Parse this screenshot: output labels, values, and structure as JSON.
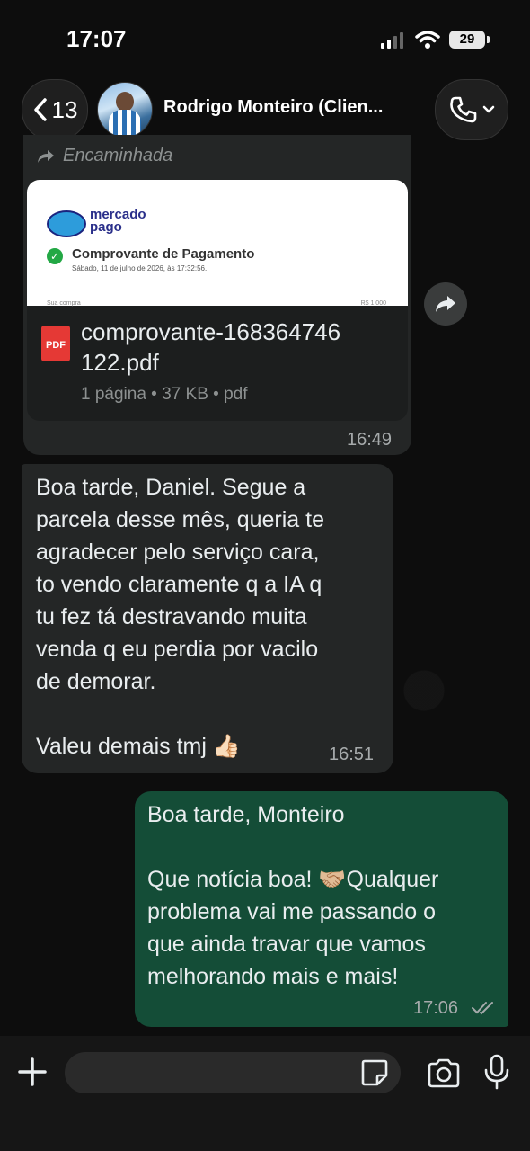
{
  "status_bar": {
    "time": "17:07",
    "battery": "29"
  },
  "header": {
    "back_count": "13",
    "contact_name": "Rodrigo Monteiro (Clien..."
  },
  "messages": {
    "forwarded": {
      "label": "Encaminhada",
      "preview": {
        "brand_line1": "mercado",
        "brand_line2": "pago",
        "title": "Comprovante de Pagamento",
        "date": "Sábado, 11 de julho de 2026, às 17:32:56.",
        "sub_left": "Sua compra",
        "sub_right": "R$ 1.000"
      },
      "file_name": "comprovante-168364746 122.pdf",
      "file_meta": "1 página • 37 KB • pdf",
      "time": "16:49"
    },
    "incoming": {
      "text": "Boa tarde, Daniel. Segue a\nparcela desse mês, queria te\nagradecer pelo serviço cara,\nto vendo claramente q a IA q\ntu fez tá destravando muita\nvenda q eu perdia por vacilo\nde demorar.\n\nValeu demais tmj 👍🏻",
      "time": "16:51"
    },
    "outgoing": {
      "text": "Boa tarde, Monteiro\n\nQue notícia boa! 🤝🏼Qualquer\nproblema vai me passando o\nque ainda travar que vamos\nmelhorando mais e mais!",
      "time": "17:06"
    }
  },
  "input": {
    "placeholder": ""
  },
  "colors": {
    "incoming_bubble": "#242626",
    "outgoing_bubble": "#144d37",
    "background": "#0b0b0b"
  },
  "icons": {
    "back": "chevron-left-icon",
    "call": "phone-icon",
    "share": "forward-icon",
    "plus": "plus-icon",
    "sticker": "sticker-icon",
    "camera": "camera-icon",
    "mic": "microphone-icon",
    "read": "double-check-icon"
  }
}
